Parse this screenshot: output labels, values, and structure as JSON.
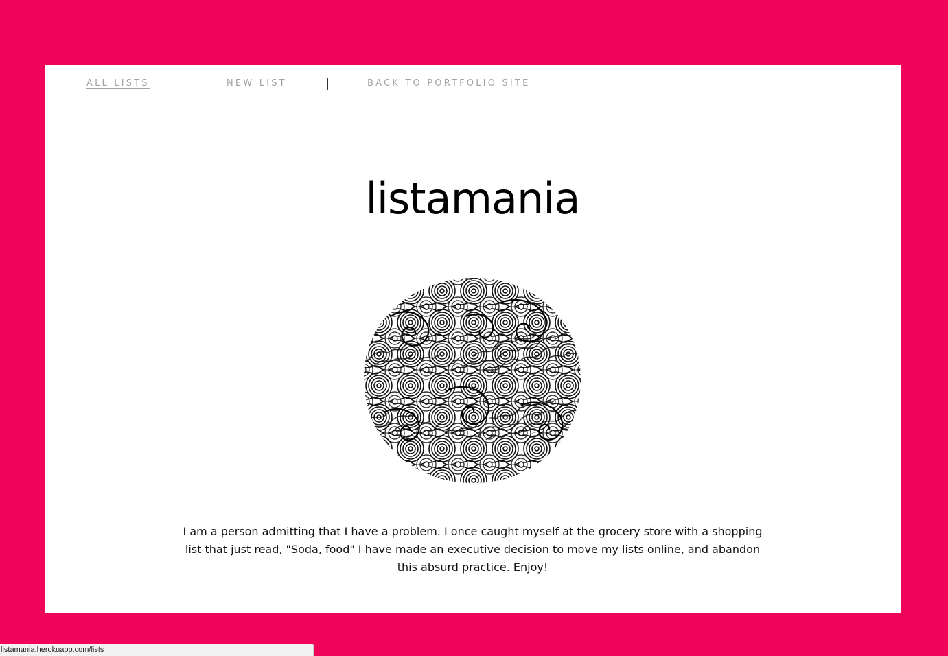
{
  "nav": {
    "items": [
      {
        "label": "ALL LISTS",
        "active": true
      },
      {
        "label": "NEW LIST",
        "active": false
      },
      {
        "label": "BACK TO PORTFOLIO SITE",
        "active": false
      }
    ]
  },
  "main": {
    "title": "listamania",
    "image_alt": "black and white swirling waves illustration",
    "description": "I am a person admitting that I have a problem. I once caught myself at the grocery store with a shopping list that just read, \"Soda, food\" I have made an executive decision to move my lists online, and abandon this absurd practice. Enjoy!"
  },
  "status_bar": {
    "url": "listamania.herokuapp.com/lists"
  },
  "colors": {
    "background": "#f0055a",
    "card": "#ffffff",
    "nav_text": "#a0a3a3"
  }
}
